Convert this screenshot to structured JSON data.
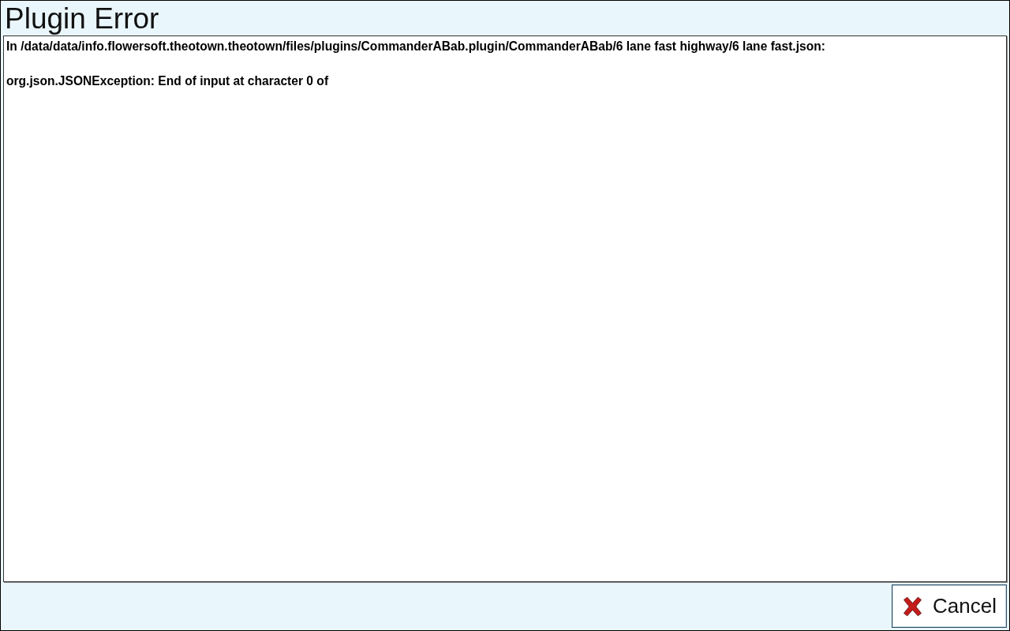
{
  "dialog": {
    "title": "Plugin Error"
  },
  "message": {
    "lines": [
      "In /data/data/info.flowersoft.theotown.theotown/files/plugins/CommanderABab.plugin/CommanderABab/6 lane fast highway/6 lane fast.json:",
      "org.json.JSONException: End of input at character 0 of"
    ]
  },
  "buttons": [
    {
      "label": "Cancel",
      "kind": "cancel"
    }
  ]
}
